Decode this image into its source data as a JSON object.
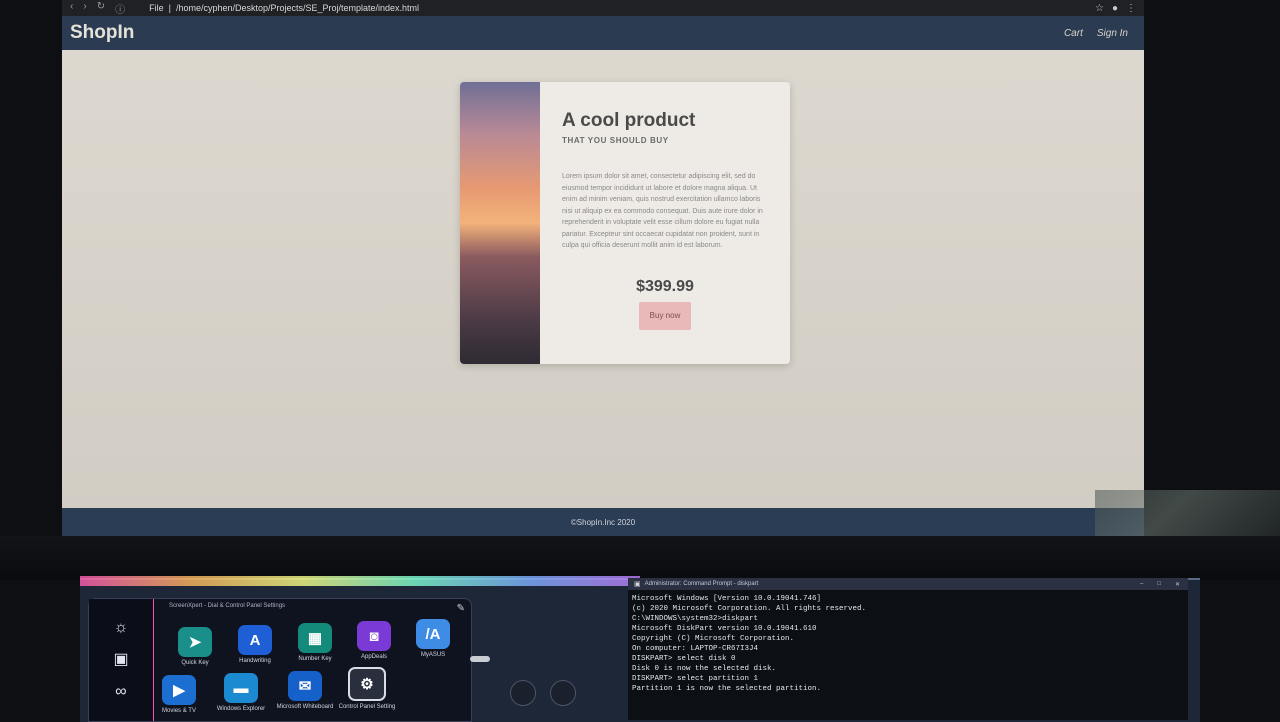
{
  "browser": {
    "url": "/home/cyphen/Desktop/Projects/SE_Proj/template/index.html",
    "url_prefix": "File",
    "icons": [
      "back-icon",
      "forward-icon",
      "reload-icon",
      "info-icon",
      "star-icon",
      "account-icon",
      "menu-icon"
    ]
  },
  "site": {
    "brand": "ShopIn",
    "nav": {
      "cart": "Cart",
      "sign_in": "Sign In"
    },
    "product": {
      "title": "A cool product",
      "subtitle": "THAT YOU SHOULD BUY",
      "description": "Lorem ipsum dolor sit amet, consectetur adipiscing elit, sed do eiusmod tempor incididunt ut labore et dolore magna aliqua. Ut enim ad minim veniam, quis nostrud exercitation ullamco laboris nisi ut aliquip ex ea commodo consequat. Duis aute irure dolor in reprehenderit in voluptate velit esse cillum dolore eu fugiat nulla pariatur. Excepteur sint occaecat cupidatat non proident, sunt in culpa qui officia deserunt mollit anim id est laborum.",
      "price": "$399.99",
      "buy_label": "Buy now"
    },
    "footer": "©ShopIn.Inc 2020"
  },
  "control_panel": {
    "title": "ScreenXpert - Dial & Control Panel Settings",
    "side_buttons": [
      "brightness-icon",
      "screen-switch-icon",
      "link-icon"
    ],
    "apps": [
      {
        "label": "Quick Key",
        "icon": "send-icon",
        "color": "#1a8f8a"
      },
      {
        "label": "Handwriting",
        "icon": "handwriting-icon",
        "color": "#1f5fd6"
      },
      {
        "label": "Number Key",
        "icon": "keypad-icon",
        "color": "#138a7a"
      },
      {
        "label": "AppDeals",
        "icon": "shopping-bag-icon",
        "color": "#7a3ad6"
      },
      {
        "label": "MyASUS",
        "icon": "myasus-icon",
        "color": "#3f8ce6"
      },
      {
        "label": "Movies & TV",
        "icon": "play-icon",
        "color": "#1c6fd0"
      },
      {
        "label": "Windows Explorer",
        "icon": "folder-icon",
        "color": "#1b8ad0"
      },
      {
        "label": "Microsoft Whiteboard",
        "icon": "whiteboard-icon",
        "color": "#1560c9"
      },
      {
        "label": "Control Panel Setting",
        "icon": "settings-gear-icon",
        "color": "#2a2f3d"
      }
    ]
  },
  "terminal": {
    "title": "Administrator: Command Prompt - diskpart",
    "lines": [
      "Microsoft Windows [Version 10.0.19041.746]",
      "(c) 2020 Microsoft Corporation. All rights reserved.",
      "",
      "C:\\WINDOWS\\system32>diskpart",
      "",
      "Microsoft DiskPart version 10.0.19041.610",
      "",
      "Copyright (C) Microsoft Corporation.",
      "On computer: LAPTOP-CR67I3J4",
      "",
      "DISKPART> select disk 0",
      "",
      "Disk 0 is now the selected disk.",
      "",
      "DISKPART> select partition 1",
      "",
      "Partition 1 is now the selected partition."
    ]
  }
}
